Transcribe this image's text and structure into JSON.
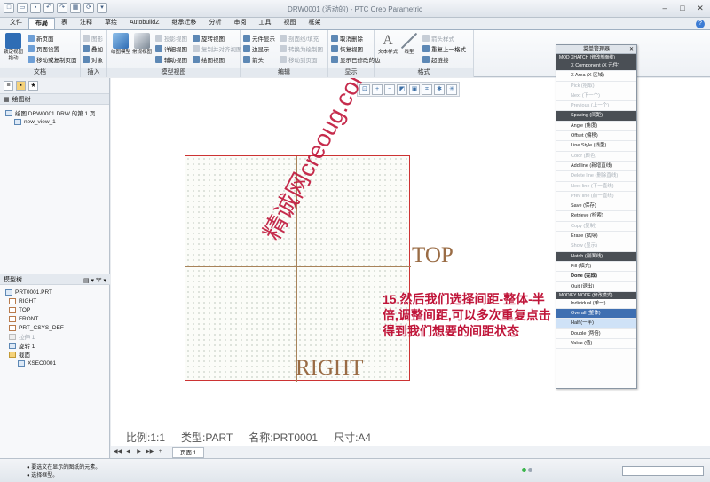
{
  "window": {
    "title": "DRW0001 (活动的) - PTC Creo Parametric"
  },
  "tabs": [
    "文件",
    "布局",
    "表",
    "注释",
    "草绘",
    "AutobuildZ",
    "继承迁移",
    "分析",
    "审阅",
    "工具",
    "视图",
    "框架"
  ],
  "active_tab": "布局",
  "ribbon": {
    "doc_group": {
      "label": "文档",
      "big": "新页面",
      "items": [
        "新页面",
        "页面设置",
        "移动或复制页面"
      ],
      "big_label": "锁定视图拖动"
    },
    "insert_group": {
      "label": "插入",
      "items": [
        "图形",
        "叠加",
        "对象"
      ]
    },
    "model_view_group": {
      "label": "模型视图",
      "big1": "绘图模型",
      "big2": "常规视图",
      "items_col1": [
        "投影视图",
        "详细视图",
        "辅助视图"
      ],
      "items_col2": [
        "旋转视图",
        "复制并对齐视图",
        "绘图视图"
      ]
    },
    "edit_group": {
      "label": "编辑",
      "items_col1": [
        "元件显示",
        "边显示",
        "箭头"
      ],
      "items_col2": [
        "剖面线/填充",
        "转换为绘制图",
        "移动到页面"
      ]
    },
    "display_group": {
      "label": "显示",
      "items": [
        "取消删除",
        "恢复视图",
        "显示已修改的边"
      ]
    },
    "format_group": {
      "label": "格式",
      "big1": "文本样式",
      "big2": "线型",
      "items": [
        "箭头样式",
        "重复上一格式",
        "超链接"
      ]
    }
  },
  "drawing_tree": {
    "title": "绘图树",
    "root": "绘图 DRW0001.DRW 的第 1 页",
    "child": "new_view_1"
  },
  "model_tree": {
    "title": "模型树",
    "items": [
      "PRT0001.PRT",
      "RIGHT",
      "TOP",
      "FRONT",
      "PRT_CSYS_DEF",
      "拉伸 1",
      "旋转 1",
      "截面",
      "XSEC0001"
    ]
  },
  "canvas": {
    "label_top": "TOP",
    "label_right": "RIGHT",
    "note_number": "15.",
    "note_text": "然后我们选择间距-整体-半倍,调整间距,可以多次重复点击得到我们想要的间距状态",
    "watermark": "精诚网creoug.com",
    "scale": "比例:1:1",
    "type": "类型:PART",
    "name": "名称:PRT0001",
    "size": "尺寸:A4"
  },
  "menu_manager": {
    "title": "菜单管理器",
    "section1": "MOD XHATCH (修改剖面线)",
    "section1_items": [
      {
        "label": "X Component (X 元件)",
        "style": "hl"
      },
      {
        "label": "X Area (X 区域)",
        "style": ""
      },
      {
        "label": "Pick (拾取)",
        "style": "dim"
      },
      {
        "label": "Next (下一个)",
        "style": "dim"
      },
      {
        "label": "Previous (上一个)",
        "style": "dim"
      },
      {
        "label": "Spacing (间距)",
        "style": "hl"
      },
      {
        "label": "Angle (角度)",
        "style": ""
      },
      {
        "label": "Offset (偏移)",
        "style": ""
      },
      {
        "label": "Line Style (线型)",
        "style": ""
      },
      {
        "label": "Color (颜色)",
        "style": "dim"
      },
      {
        "label": "Add line (新增直线)",
        "style": ""
      },
      {
        "label": "Delete line (删除直线)",
        "style": "dim"
      },
      {
        "label": "Next line (下一直线)",
        "style": "dim"
      },
      {
        "label": "Prev line (前一直线)",
        "style": "dim"
      },
      {
        "label": "Save (保存)",
        "style": ""
      },
      {
        "label": "Retrieve (检索)",
        "style": ""
      },
      {
        "label": "Copy (复制)",
        "style": "dim"
      },
      {
        "label": "Erase (拭除)",
        "style": ""
      },
      {
        "label": "Show (显示)",
        "style": "dim"
      },
      {
        "label": "Hatch (剖面线)",
        "style": "hl"
      },
      {
        "label": "Fill (填充)",
        "style": ""
      },
      {
        "label": "Done (完成)",
        "style": "bold"
      },
      {
        "label": "Quit (退出)",
        "style": ""
      }
    ],
    "section2": "MODIFY MODE (修改模式)",
    "section2_items": [
      {
        "label": "Individual (单一)",
        "style": ""
      },
      {
        "label": "Overall (整体)",
        "style": "sel"
      },
      {
        "label": "Half (一半)",
        "style": "cur"
      },
      {
        "label": "Double (两倍)",
        "style": ""
      },
      {
        "label": "Value (值)",
        "style": ""
      }
    ]
  },
  "page_tabs": {
    "page": "页面 1"
  },
  "status": {
    "line1": "● 要选文在显示的图纸的元素。",
    "line2": "● 选择框型。"
  },
  "colors": {
    "accent": "#3f6fb1",
    "note": "#c0163a",
    "sheet_border": "#cc3333",
    "datum": "#9a6c45"
  }
}
